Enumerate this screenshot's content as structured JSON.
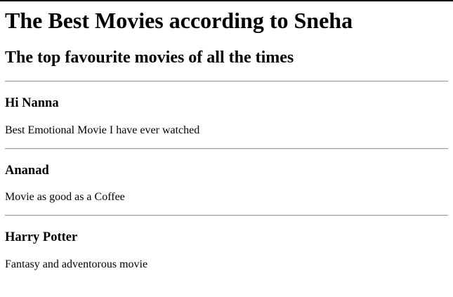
{
  "page": {
    "title": "The Best Movies according to Sneha",
    "subtitle": "The top favourite movies of all the times"
  },
  "movies": [
    {
      "title": "Hi Nanna",
      "description": "Best Emotional Movie I have ever watched"
    },
    {
      "title": "Ananad",
      "description": "Movie as good as a Coffee"
    },
    {
      "title": "Harry Potter",
      "description": "Fantasy and adventorous movie"
    }
  ]
}
